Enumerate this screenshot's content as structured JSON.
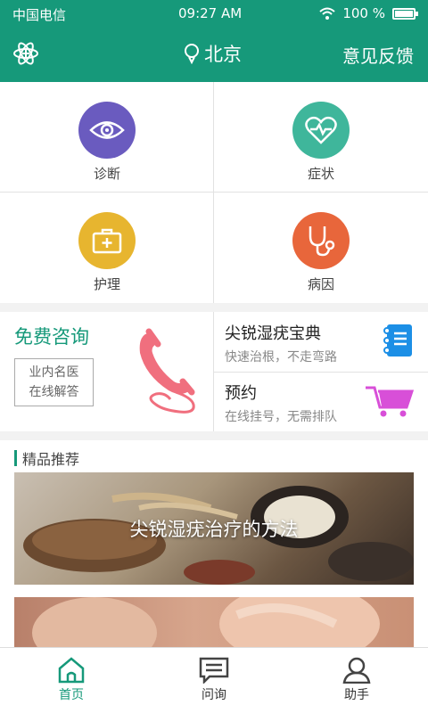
{
  "status": {
    "carrier": "中国电信",
    "time": "09:27 AM",
    "battery": "100 %",
    "battery_level": 1.0
  },
  "header": {
    "location": "北京",
    "feedback": "意见反馈"
  },
  "colors": {
    "brand": "#16997a"
  },
  "grid": [
    {
      "label": "诊断",
      "icon": "eye-icon",
      "color": "#6a5bbf"
    },
    {
      "label": "症状",
      "icon": "heart-pulse-icon",
      "color": "#3fb69b"
    },
    {
      "label": "护理",
      "icon": "first-aid-kit-icon",
      "color": "#e7b52f"
    },
    {
      "label": "病因",
      "icon": "stethoscope-icon",
      "color": "#e8663b"
    }
  ],
  "promo": {
    "title": "免费咨询",
    "tag_line1": "业内名医",
    "tag_line2": "在线解答",
    "items": [
      {
        "title": "尖锐湿疣宝典",
        "subtitle": "快速治根，不走弯路",
        "icon": "notebook-icon"
      },
      {
        "title": "预约",
        "subtitle": "在线挂号，无需排队",
        "icon": "cart-icon"
      }
    ]
  },
  "section": {
    "title": "精品推荐"
  },
  "banners": [
    {
      "caption": "尖锐湿疣治疗的方法"
    }
  ],
  "tabs": [
    {
      "label": "首页",
      "icon": "home-icon",
      "active": true
    },
    {
      "label": "问询",
      "icon": "chat-icon",
      "active": false
    },
    {
      "label": "助手",
      "icon": "user-icon",
      "active": false
    }
  ]
}
